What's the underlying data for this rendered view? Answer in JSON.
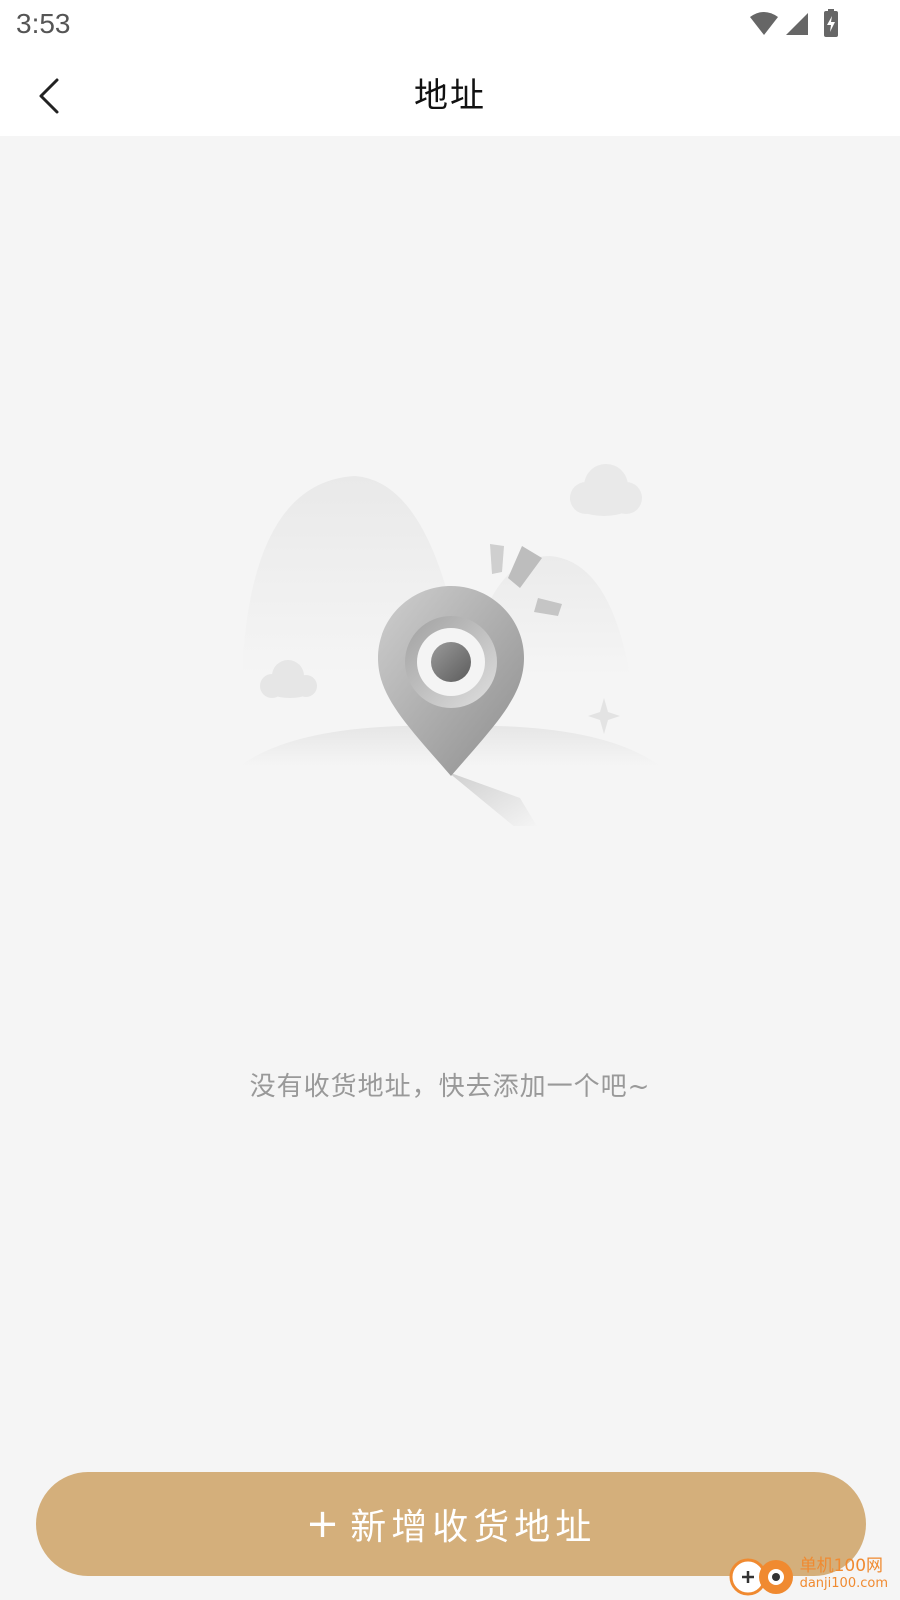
{
  "status_bar": {
    "time": "3:53",
    "icons": [
      "wifi-icon",
      "cellular-signal-icon",
      "battery-charging-icon"
    ]
  },
  "nav": {
    "title": "地址",
    "back_icon": "chevron-left-icon"
  },
  "empty_state": {
    "illustration": "location-pin-illustration",
    "message": "没有收货地址，快去添加一个吧~"
  },
  "add_button": {
    "icon": "plus-icon",
    "plus": "+",
    "label": "新增收货地址",
    "color": "#d4af7b"
  },
  "watermark": {
    "cn": "单机100网",
    "en": "danji100.com"
  },
  "colors": {
    "background": "#f5f5f5",
    "accent": "#d4af7b",
    "muted_text": "#999999"
  }
}
